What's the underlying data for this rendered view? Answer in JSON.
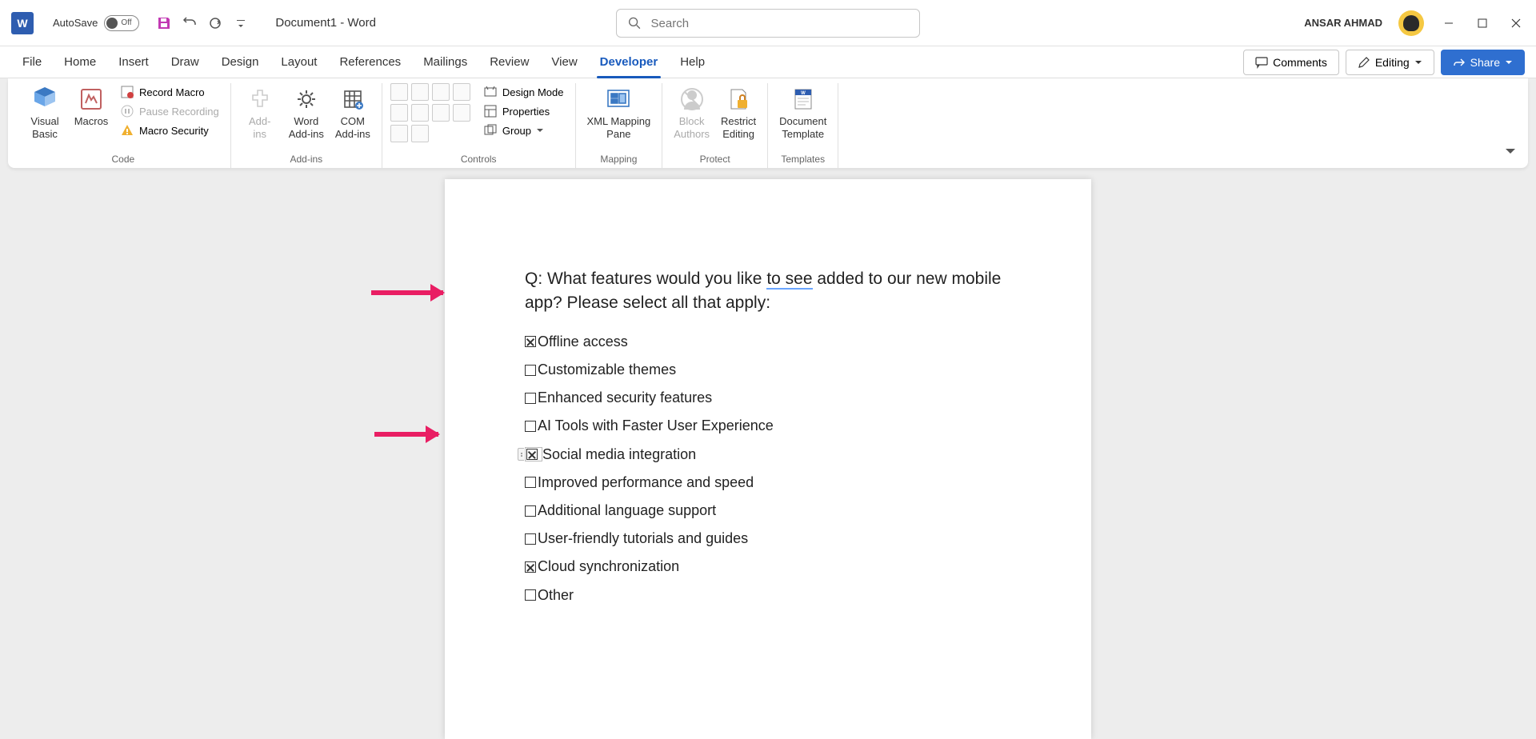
{
  "title_bar": {
    "autosave_label": "AutoSave",
    "autosave_state": "Off",
    "doc_title": "Document1  -  Word",
    "search_placeholder": "Search",
    "user_name": "ANSAR AHMAD"
  },
  "tabs": {
    "items": [
      "File",
      "Home",
      "Insert",
      "Draw",
      "Design",
      "Layout",
      "References",
      "Mailings",
      "Review",
      "View",
      "Developer",
      "Help"
    ],
    "active": "Developer",
    "comments_btn": "Comments",
    "editing_btn": "Editing",
    "share_btn": "Share"
  },
  "ribbon": {
    "code": {
      "visual_basic": "Visual\nBasic",
      "macros": "Macros",
      "record_macro": "Record Macro",
      "pause_recording": "Pause Recording",
      "macro_security": "Macro Security",
      "group_label": "Code"
    },
    "addins": {
      "addins": "Add-\nins",
      "word_addins": "Word\nAdd-ins",
      "com_addins": "COM\nAdd-ins",
      "group_label": "Add-ins"
    },
    "controls": {
      "design_mode": "Design Mode",
      "properties": "Properties",
      "group_btn": "Group",
      "group_label": "Controls"
    },
    "mapping": {
      "xml_mapping": "XML Mapping\nPane",
      "group_label": "Mapping"
    },
    "protect": {
      "block_authors": "Block\nAuthors",
      "restrict_editing": "Restrict\nEditing",
      "group_label": "Protect"
    },
    "templates": {
      "doc_template": "Document\nTemplate",
      "group_label": "Templates"
    }
  },
  "document": {
    "question_pre": "Q: What features would you like ",
    "question_spell": "to see",
    "question_post": " added to our new mobile app? Please select all that apply:",
    "options": [
      {
        "label": "Offline access",
        "checked": true,
        "selected": false
      },
      {
        "label": "Customizable themes",
        "checked": false,
        "selected": false
      },
      {
        "label": "Enhanced security features",
        "checked": false,
        "selected": false
      },
      {
        "label": "AI Tools with Faster User Experience",
        "checked": false,
        "selected": false
      },
      {
        "label": "Social media integration",
        "checked": true,
        "selected": true
      },
      {
        "label": "Improved performance and speed",
        "checked": false,
        "selected": false
      },
      {
        "label": "Additional language support",
        "checked": false,
        "selected": false
      },
      {
        "label": "User-friendly tutorials and guides",
        "checked": false,
        "selected": false
      },
      {
        "label": "Cloud synchronization",
        "checked": true,
        "selected": false
      },
      {
        "label": "Other",
        "checked": false,
        "selected": false
      }
    ]
  }
}
